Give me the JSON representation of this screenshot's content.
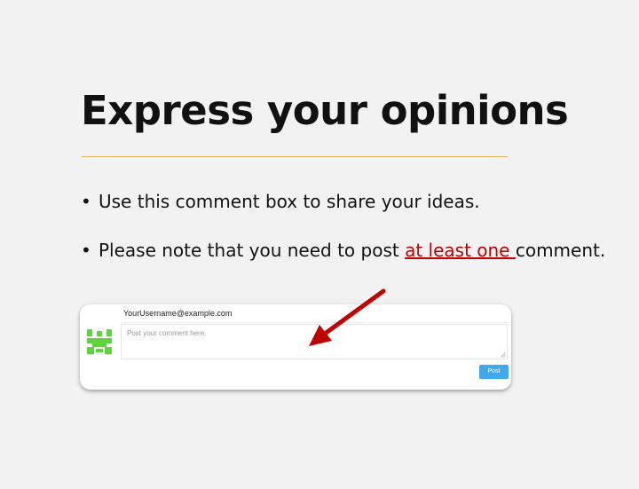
{
  "slide": {
    "title": "Express your opinions",
    "bullet_glyph": "•",
    "bullets": [
      {
        "text": "Use this comment box to share your ideas."
      },
      {
        "before": "Please note that you need to post ",
        "emphasis": "at least one ",
        "after": "comment."
      }
    ]
  },
  "comment_widget": {
    "username": "YourUsername@example.com",
    "placeholder": "Post your comment here.",
    "post_label": "Post",
    "avatar_icon": "identicon-avatar",
    "arrow_icon": "red-pointer-arrow-icon"
  },
  "colors": {
    "background": "#f2f2f2",
    "title_rule": "#e2b363",
    "emphasis_red": "#c00000",
    "post_button": "#42a8ec",
    "avatar_green": "#5fd33d",
    "arrow_red": "#c00000"
  }
}
